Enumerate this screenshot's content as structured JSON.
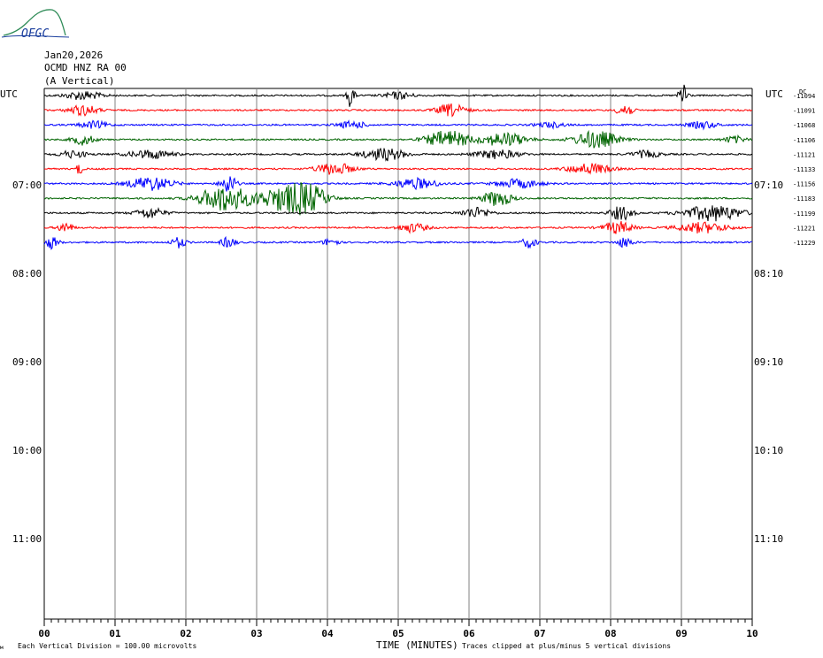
{
  "header": {
    "logo_text": "OFGC",
    "date": "Jan20,2026",
    "station": "OCMD HNZ RA 00",
    "component": "(A Vertical)"
  },
  "chart_data": {
    "type": "line",
    "title": "",
    "xlabel": "TIME (MINUTES)",
    "ylabel": "",
    "xlim": [
      0,
      10
    ],
    "x_ticks": [
      "00",
      "01",
      "02",
      "03",
      "04",
      "05",
      "06",
      "07",
      "08",
      "09",
      "10"
    ],
    "left_axis_title": "UTC",
    "right_axis_title": "UTC",
    "left_hour_labels": [
      "07:00",
      "08:00",
      "09:00",
      "10:00",
      "11:00"
    ],
    "right_hour_labels": [
      "07:10",
      "08:10",
      "09:10",
      "10:10",
      "11:10"
    ],
    "dc_label": "DC",
    "grid": true,
    "trace_colors": [
      "#000000",
      "#ff0000",
      "#0000ff",
      "#006400"
    ],
    "series": [
      {
        "dc": "-11094",
        "bursts": [
          [
            0.55,
            0.25,
            5
          ],
          [
            4.33,
            0.05,
            14
          ],
          [
            5.0,
            0.2,
            4
          ],
          [
            9.03,
            0.06,
            18
          ]
        ]
      },
      {
        "dc": "-11091",
        "bursts": [
          [
            0.55,
            0.2,
            6
          ],
          [
            5.75,
            0.2,
            7
          ],
          [
            8.2,
            0.1,
            9
          ]
        ]
      },
      {
        "dc": "-11068",
        "bursts": [
          [
            0.7,
            0.2,
            4
          ],
          [
            4.35,
            0.2,
            4
          ],
          [
            7.15,
            0.2,
            3
          ],
          [
            9.3,
            0.2,
            4
          ]
        ]
      },
      {
        "dc": "-11106",
        "bursts": [
          [
            0.55,
            0.15,
            6
          ],
          [
            5.7,
            0.3,
            10
          ],
          [
            6.5,
            0.3,
            8
          ],
          [
            7.8,
            0.3,
            10
          ],
          [
            9.75,
            0.15,
            4
          ]
        ]
      },
      {
        "dc": "-11121",
        "bursts": [
          [
            0.4,
            0.2,
            4
          ],
          [
            1.5,
            0.3,
            5
          ],
          [
            4.8,
            0.3,
            7
          ],
          [
            6.4,
            0.3,
            5
          ],
          [
            8.5,
            0.2,
            4
          ]
        ]
      },
      {
        "dc": "-11133",
        "bursts": [
          [
            0.5,
            0.05,
            6
          ],
          [
            4.1,
            0.25,
            7
          ],
          [
            7.7,
            0.3,
            6
          ]
        ]
      },
      {
        "dc": "-11156",
        "bursts": [
          [
            1.5,
            0.3,
            8
          ],
          [
            2.6,
            0.1,
            12
          ],
          [
            5.25,
            0.3,
            6
          ],
          [
            6.7,
            0.3,
            5
          ]
        ]
      },
      {
        "dc": "-11183",
        "bursts": [
          [
            2.55,
            0.35,
            15
          ],
          [
            3.4,
            0.35,
            14
          ],
          [
            3.75,
            0.25,
            12
          ],
          [
            6.4,
            0.2,
            9
          ]
        ]
      },
      {
        "dc": "-11199",
        "bursts": [
          [
            1.5,
            0.2,
            6
          ],
          [
            6.1,
            0.2,
            6
          ],
          [
            8.15,
            0.15,
            8
          ],
          [
            9.45,
            0.4,
            9
          ]
        ]
      },
      {
        "dc": "-11221",
        "bursts": [
          [
            0.3,
            0.1,
            6
          ],
          [
            5.2,
            0.2,
            5
          ],
          [
            8.1,
            0.2,
            7
          ],
          [
            9.3,
            0.35,
            6
          ]
        ]
      },
      {
        "dc": "-11229",
        "bursts": [
          [
            0.1,
            0.1,
            7
          ],
          [
            1.9,
            0.1,
            6
          ],
          [
            2.6,
            0.1,
            6
          ],
          [
            4.05,
            0.1,
            5
          ],
          [
            6.85,
            0.1,
            6
          ],
          [
            8.2,
            0.1,
            6
          ]
        ]
      }
    ]
  },
  "footer": {
    "scale_note": "Each Vertical Division =  100.00 microvolts",
    "clip_note": "Traces clipped at plus/minus 5 vertical divisions"
  }
}
